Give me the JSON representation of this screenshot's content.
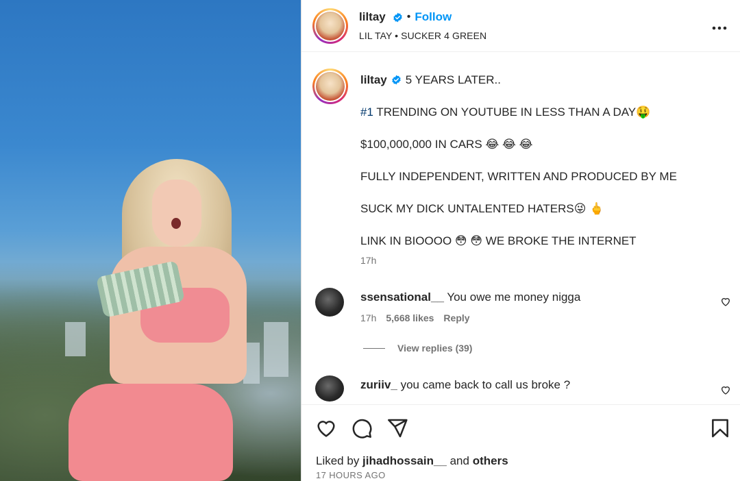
{
  "post": {
    "username": "liltay",
    "follow_label": "Follow",
    "audio": "LIL TAY • SUCKER 4 GREEN",
    "more_label": "•••"
  },
  "caption": {
    "username": "liltay",
    "line1": "5 YEARS LATER..",
    "hashtag": "#1",
    "line2": " TRENDING ON YOUTUBE IN LESS THAN A DAY🤑",
    "line3": "$100,000,000 IN CARS 😂 😂 😂",
    "line4": "FULLY INDEPENDENT, WRITTEN AND PRODUCED BY ME",
    "line5": "SUCK MY DICK UNTALENTED HATERS😜 🖕",
    "line6": "LINK IN BIOOOO 😳 😳 WE BROKE THE INTERNET",
    "time": "17h"
  },
  "comments": [
    {
      "username": "ssensational__",
      "text": "You owe me money nigga",
      "time": "17h",
      "likes": "5,668 likes",
      "reply_label": "Reply"
    },
    {
      "username": "zuriiv_",
      "text": "you came back to call us broke ?"
    }
  ],
  "view_replies": "View replies (39)",
  "footer": {
    "liked_prefix": "Liked by ",
    "liked_user": "jihadhossain__",
    "liked_and": " and ",
    "liked_others": "others",
    "posted": "17 HOURS AGO"
  },
  "colors": {
    "link_blue": "#0095f6",
    "hashtag": "#00376b",
    "muted": "#737373",
    "text": "#262626"
  }
}
